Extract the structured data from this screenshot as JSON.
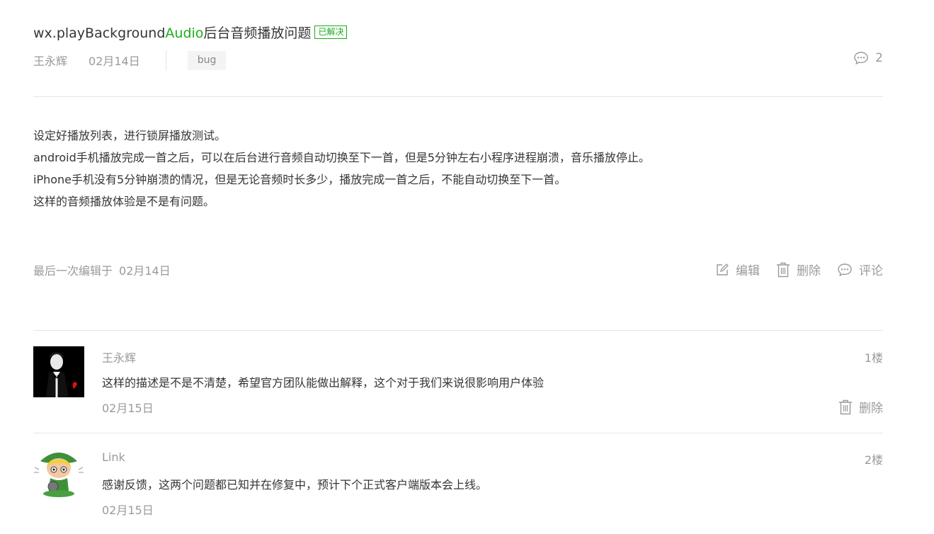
{
  "post": {
    "title_prefix": "wx.playBackground",
    "title_highlight": "Audio",
    "title_suffix": "后台音频播放问题",
    "status_badge": "已解决",
    "author": "王永辉",
    "date": "02月14日",
    "tag": "bug",
    "comment_count": "2",
    "body": [
      "设定好播放列表，进行锁屏播放测试。",
      "android手机播放完成一首之后，可以在后台进行音频自动切换至下一首，但是5分钟左右小程序进程崩溃，音乐播放停止。",
      "iPhone手机没有5分钟崩溃的情况，但是无论音频时长多少，播放完成一首之后，不能自动切换至下一首。",
      "这样的音频播放体验是不是有问题。"
    ],
    "last_edit_label": "最后一次编辑于",
    "last_edit_date": "02月14日",
    "actions": {
      "edit": "编辑",
      "delete": "删除",
      "comment": "评论"
    }
  },
  "replies": [
    {
      "author": "王永辉",
      "floor": "1楼",
      "text": "这样的描述是不是不清楚，希望官方团队能做出解释，这个对于我们来说很影响用户体验",
      "date": "02月15日",
      "delete_label": "删除",
      "avatar_icon": "man-in-tuxedo-avatar"
    },
    {
      "author": "Link",
      "floor": "2楼",
      "text": "感谢反馈，这两个问题都已知并在修复中，预计下个正式客户端版本会上线。",
      "date": "02月15日",
      "avatar_icon": "octocat-link-avatar"
    }
  ],
  "colors": {
    "accent": "#1aad19",
    "muted": "#9a9a9a",
    "text": "#353535",
    "divider": "#e5e5e5"
  }
}
